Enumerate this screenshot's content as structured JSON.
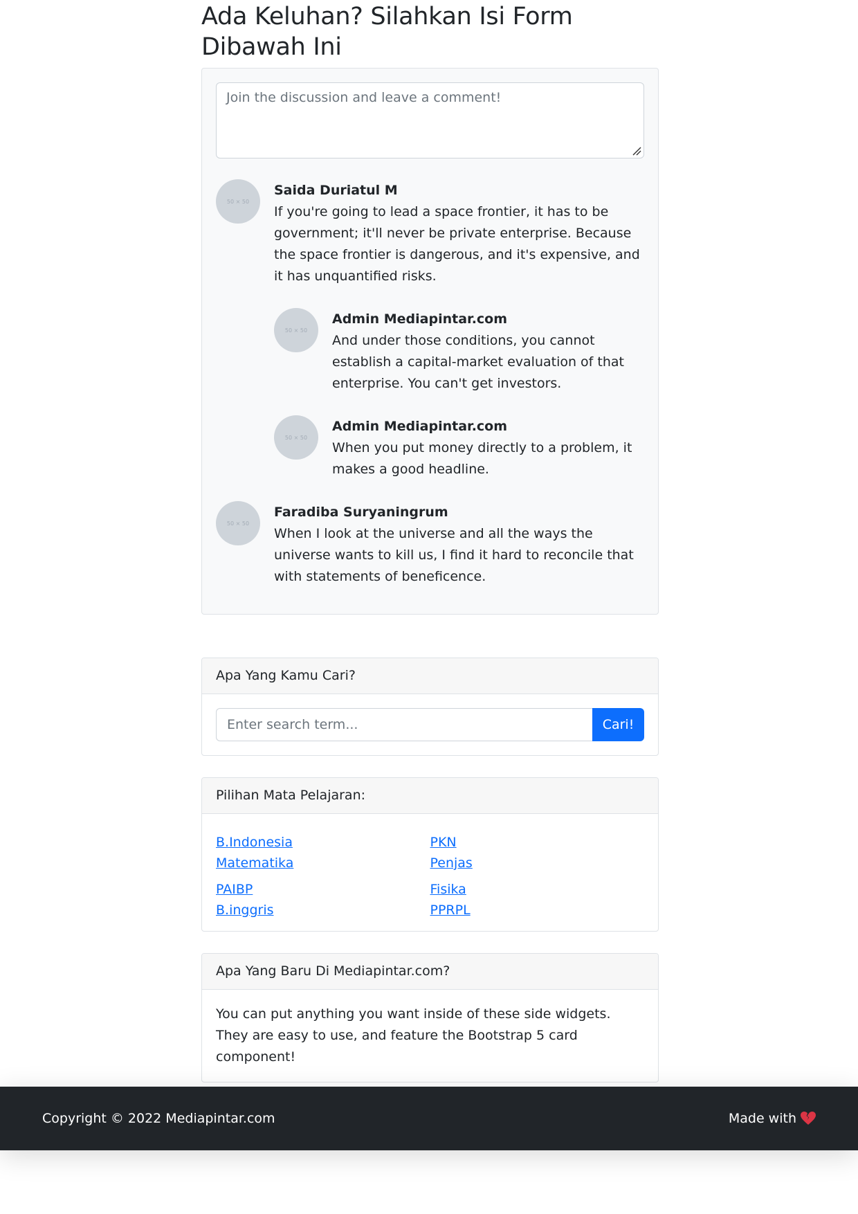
{
  "page": {
    "title": "Ada Keluhan? Silahkan Isi Form Dibawah Ini"
  },
  "comments": {
    "textarea_placeholder": "Join the discussion and leave a comment!",
    "avatar_text": "50 × 50",
    "items": [
      {
        "author": "Saida Duriatul M",
        "text": "If you're going to lead a space frontier, it has to be government; it'll never be private enterprise. Because the space frontier is dangerous, and it's expensive, and it has unquantified risks.",
        "replies": [
          {
            "author": "Admin Mediapintar.com",
            "text": "And under those conditions, you cannot establish a capital-market evaluation of that enterprise. You can't get investors."
          },
          {
            "author": "Admin Mediapintar.com",
            "text": "When you put money directly to a problem, it makes a good headline."
          }
        ]
      },
      {
        "author": "Faradiba Suryaningrum",
        "text": "When I look at the universe and all the ways the universe wants to kill us, I find it hard to reconcile that with statements of beneficence."
      }
    ]
  },
  "search": {
    "header": "Apa Yang Kamu Cari?",
    "placeholder": "Enter search term...",
    "button_label": "Cari!"
  },
  "subjects": {
    "header": "Pilihan Mata Pelajaran:",
    "left": [
      [
        "B.Indonesia",
        "Matematika"
      ],
      [
        "PAIBP",
        "B.inggris"
      ]
    ],
    "right": [
      [
        "PKN",
        "Penjas"
      ],
      [
        "Fisika",
        "PPRPL"
      ]
    ]
  },
  "news": {
    "header": "Apa Yang Baru Di Mediapintar.com?",
    "text": "You can put anything you want inside of these side widgets. They are easy to use, and feature the Bootstrap 5 card component!"
  },
  "footer": {
    "copyright": "Copyright © 2022 Mediapintar.com",
    "made_with": "Made with",
    "heart_icon": "broken-heart-icon",
    "heart_color": "#dc3545"
  },
  "colors": {
    "primary": "#0d6efd",
    "footer_bg": "#212529",
    "card_bg": "#f8f9fa"
  }
}
